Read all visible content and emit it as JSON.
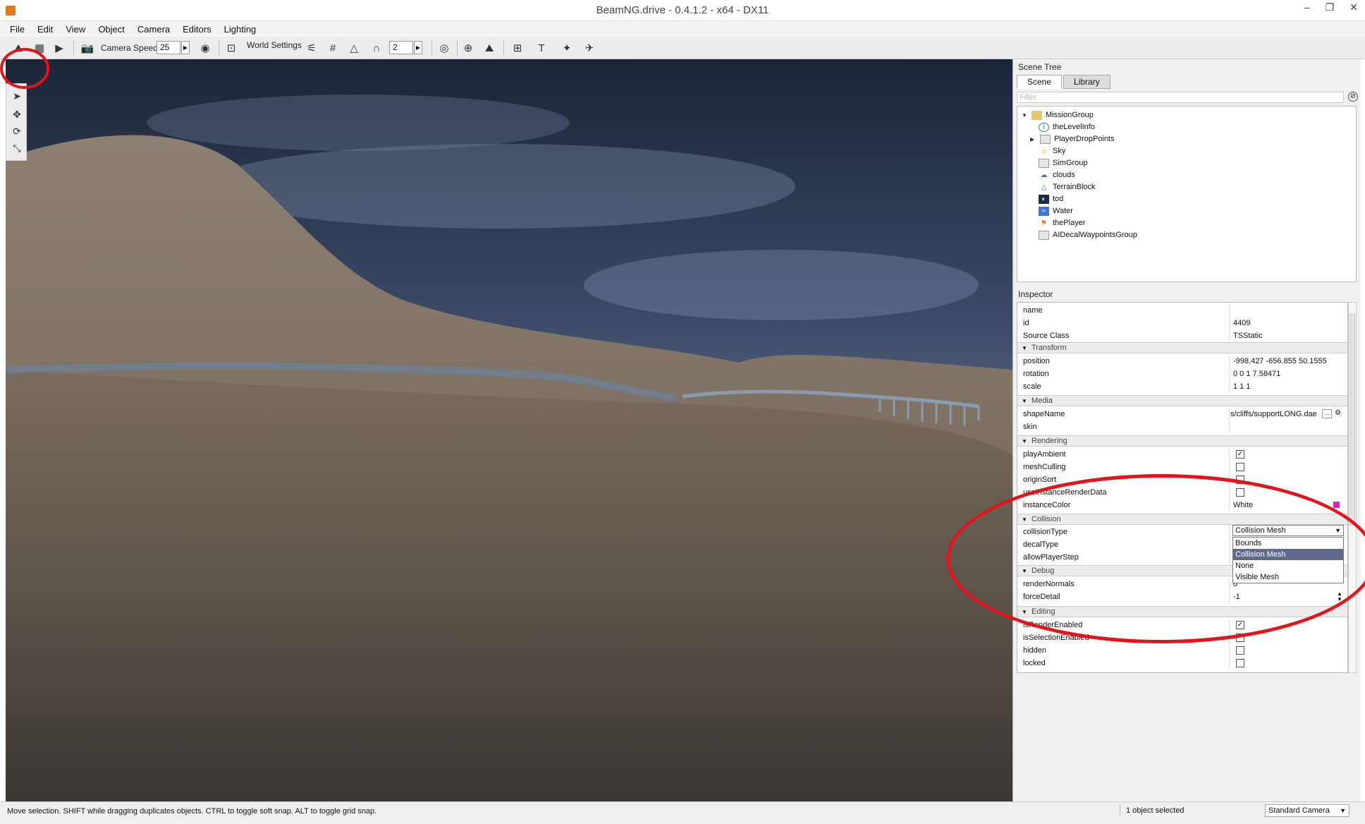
{
  "window": {
    "title": "BeamNG.drive - 0.4.1.2 - x64 - DX11",
    "controls": [
      "–",
      "❐",
      "✕"
    ]
  },
  "menu": [
    "File",
    "Edit",
    "View",
    "Object",
    "Camera",
    "Editors",
    "Lighting"
  ],
  "toolbar": {
    "camera_speed_label": "Camera Speed",
    "camera_speed_value": "25",
    "world_settings_label": "World Settings",
    "grid_value": "2"
  },
  "scene_tree": {
    "header": "Scene Tree",
    "tabs": [
      "Scene",
      "Library"
    ],
    "filter_placeholder": "Filter",
    "items": [
      {
        "label": "MissionGroup",
        "icon": "folder-open-icon"
      },
      {
        "label": "theLevelInfo",
        "icon": "info-icon"
      },
      {
        "label": "PlayerDropPoints",
        "icon": "folder-icon"
      },
      {
        "label": "Sky",
        "icon": "sky-icon"
      },
      {
        "label": "SimGroup",
        "icon": "folder-icon"
      },
      {
        "label": "clouds",
        "icon": "clouds-icon"
      },
      {
        "label": "TerrainBlock",
        "icon": "terrain-icon"
      },
      {
        "label": "tod",
        "icon": "time-of-day-icon"
      },
      {
        "label": "Water",
        "icon": "water-icon"
      },
      {
        "label": "thePlayer",
        "icon": "player-icon"
      },
      {
        "label": "AIDecalWaypointsGroup",
        "icon": "folder-icon"
      }
    ]
  },
  "inspector": {
    "header": "Inspector",
    "fields": {
      "name": {
        "key": "name",
        "value": ""
      },
      "id": {
        "key": "id",
        "value": "4409"
      },
      "source_class": {
        "key": "Source Class",
        "value": "TSStatic"
      },
      "position": {
        "key": "position",
        "value": "-998.427 -656.855 50.1555"
      },
      "rotation": {
        "key": "rotation",
        "value": "0 0 1 7.58471"
      },
      "scale": {
        "key": "scale",
        "value": "1 1 1"
      },
      "shape_name": {
        "key": "shapeName",
        "value": "s/cliffs/supportLONG.dae"
      },
      "skin": {
        "key": "skin",
        "value": ""
      },
      "play_ambient": {
        "key": "playAmbient",
        "checked": true
      },
      "mesh_culling": {
        "key": "meshCulling",
        "checked": false
      },
      "origin_sort": {
        "key": "originSort",
        "checked": false
      },
      "instance_render_data": {
        "key": "useInstanceRenderData",
        "checked": false
      },
      "instance_color": {
        "key": "instanceColor",
        "value": "White",
        "swatch": "#e619c9"
      },
      "collision_type": {
        "key": "collisionType",
        "value": "Collision Mesh"
      },
      "decal_type": {
        "key": "decalType",
        "value": ""
      },
      "allow_player_step": {
        "key": "allowPlayerStep",
        "value": ""
      },
      "render_normals": {
        "key": "renderNormals",
        "value": "0"
      },
      "force_detail": {
        "key": "forceDetail",
        "value": "-1"
      },
      "render_enabled": {
        "key": "isRenderEnabled",
        "checked": true
      },
      "selection_enabled": {
        "key": "isSelectionEnabled",
        "checked": false
      },
      "hidden": {
        "key": "hidden",
        "checked": false
      },
      "locked": {
        "key": "locked",
        "checked": false
      }
    },
    "sections": [
      "Transform",
      "Media",
      "Rendering",
      "Collision",
      "Debug",
      "Editing"
    ],
    "collision_options": [
      "Bounds",
      "Collision Mesh",
      "None",
      "Visible Mesh"
    ],
    "collision_selected": "Collision Mesh"
  },
  "status": {
    "message": "Move selection.  SHIFT while dragging duplicates objects.  CTRL to toggle soft snap.  ALT to toggle grid snap.",
    "selection": "1 object selected",
    "camera_mode": "Standard Camera"
  },
  "colors": {
    "annotation": "#e4141b",
    "sky": "#26324a",
    "terrain": "#7a6c5c"
  }
}
